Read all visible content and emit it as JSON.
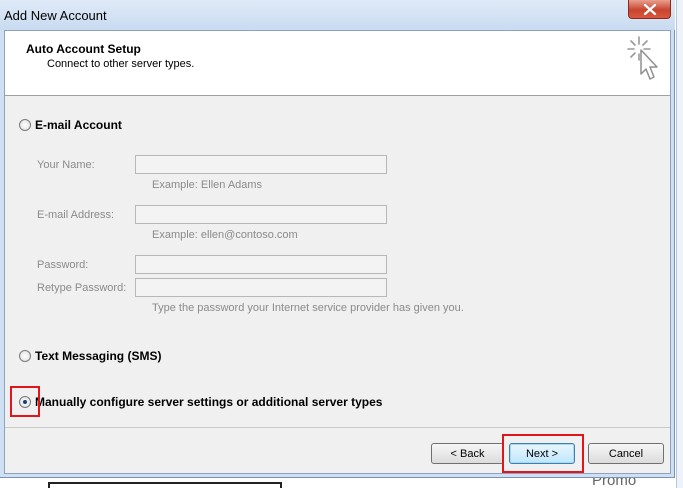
{
  "window": {
    "title": "Add New Account",
    "close_icon": "close-icon"
  },
  "background": {
    "promo_text": "Promo"
  },
  "header": {
    "title": "Auto Account Setup",
    "subtitle": "Connect to other server types.",
    "icon": "wizard-cursor-icon"
  },
  "options": {
    "email_account": {
      "label": "E-mail Account",
      "selected": false
    },
    "sms": {
      "label": "Text Messaging (SMS)",
      "selected": false
    },
    "manual": {
      "label": "Manually configure server settings or additional server types",
      "selected": true
    }
  },
  "form": {
    "your_name": {
      "label": "Your Name:",
      "value": "",
      "hint": "Example: Ellen Adams"
    },
    "email_address": {
      "label": "E-mail Address:",
      "value": "",
      "hint": "Example: ellen@contoso.com"
    },
    "password": {
      "label": "Password:",
      "value": ""
    },
    "retype_password": {
      "label": "Retype Password:",
      "value": "",
      "hint": "Type the password your Internet service provider has given you."
    }
  },
  "buttons": {
    "back": "< Back",
    "next": "Next >",
    "cancel": "Cancel"
  },
  "colors": {
    "highlight": "#e2141c",
    "title_bar": "#cfe0f4"
  }
}
